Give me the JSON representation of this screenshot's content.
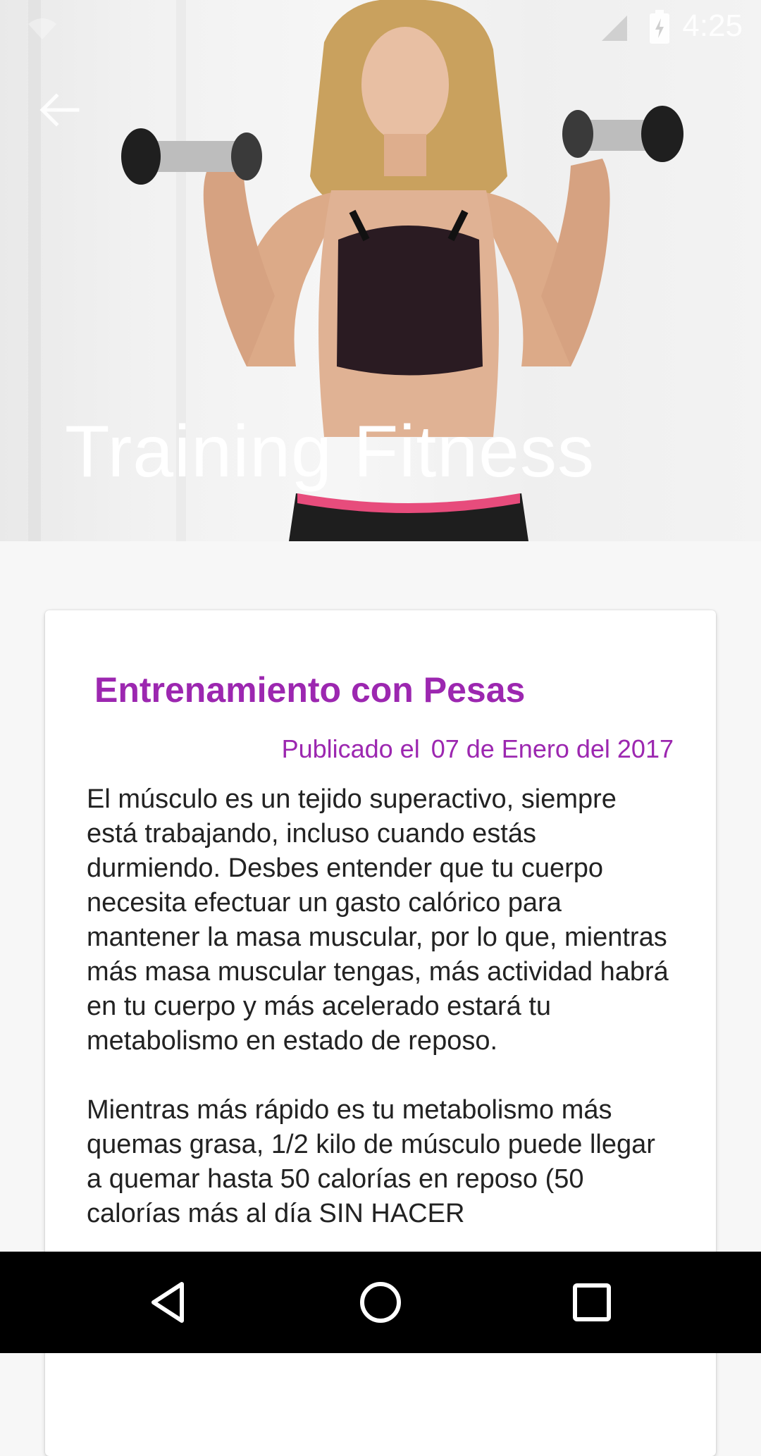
{
  "status_bar": {
    "time": "4:25",
    "icons": [
      "wifi-icon",
      "signal-icon",
      "battery-icon"
    ]
  },
  "toolbar": {
    "back_icon": "arrow-back-icon",
    "title": "Training Fitness"
  },
  "article": {
    "title": "Entrenamiento con Pesas",
    "date_prefix": "Publicado el",
    "date": "07 de Enero del 2017",
    "paragraphs": [
      "El músculo es un tejido superactivo, siempre está trabajando, incluso cuando estás durmiendo. Desbes entender que tu cuerpo necesita efectuar un gasto calórico para mantener la masa muscular, por lo que, mientras más masa muscular tengas, más actividad habrá en tu cuerpo y más acelerado estará tu metabolismo en estado de reposo.",
      "Mientras más rápido es tu metabolismo más quemas grasa, 1/2 kilo de músculo puede llegar a quemar hasta 50 calorías en reposo (50 calorías más al día SIN HACER"
    ]
  },
  "nav_bar": {
    "buttons": [
      "back-triangle-icon",
      "home-circle-icon",
      "recents-square-icon"
    ]
  },
  "colors": {
    "accent": "#9c27b0",
    "body_text": "#222222",
    "background": "#f7f7f7",
    "nav_bar": "#000000"
  }
}
